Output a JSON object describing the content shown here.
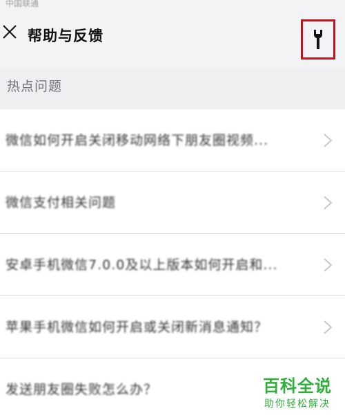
{
  "status_bar": {
    "text": "中国联通"
  },
  "header": {
    "title": "帮助与反馈"
  },
  "section": {
    "title": "热点问题"
  },
  "questions": [
    {
      "text": "微信如何开启关闭移动网络下朋友圈视频..."
    },
    {
      "text": "微信支付相关问题"
    },
    {
      "text": "安卓手机微信7.0.0及以上版本如何开启和..."
    },
    {
      "text": "苹果手机微信如何开启或关闭新消息通知？"
    },
    {
      "text": "发送朋友圈失败怎么办？"
    }
  ],
  "watermark": {
    "main": "百科全说",
    "sub": "助你轻松解决"
  },
  "colors": {
    "header_bg": "#f3f3f5",
    "highlight_border": "#c0141c",
    "watermark": "#2fae3a"
  }
}
